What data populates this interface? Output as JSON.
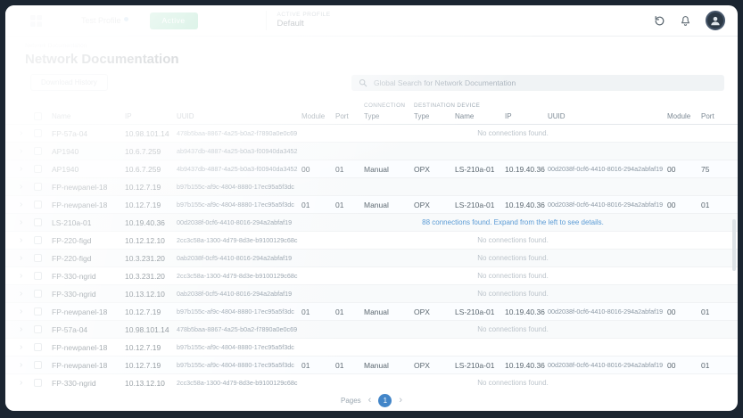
{
  "header": {
    "profile_name": "Test Profile",
    "active_button_label": "Active",
    "active_profile_label": "ACTIVE PROFILE",
    "active_profile_value": "Default"
  },
  "page": {
    "breadcrumb": "Network Documentation",
    "title": "Network Documentation",
    "history_button_label": "Download History",
    "search_placeholder": "Global Search for Network Documentation"
  },
  "icons": {
    "expand_chevron": "›"
  },
  "colors": {
    "accent_blue": "#4285c8",
    "active_green": "#2bb673",
    "info_blue": "#5b9bd5"
  },
  "table": {
    "groups": {
      "connection": "CONNECTION",
      "destination": "DESTINATION DEVICE"
    },
    "columns": {
      "name": "Name",
      "ip": "IP",
      "uuid": "UUID",
      "module": "Module",
      "port": "Port",
      "conn_type": "Type",
      "dest_type": "Type",
      "dest_name": "Name",
      "dest_ip": "IP",
      "dest_uuid": "UUID",
      "dest_module": "Module",
      "dest_port": "Port"
    },
    "rows": [
      {
        "name": "FP-57a-04",
        "ip": "10.98.101.14",
        "uuid": "478b5baa-8867-4a25-b0a2-f7890a0e0c69",
        "message": "No connections found."
      },
      {
        "name": "AP1940",
        "ip": "10.6.7.259",
        "uuid": "ab9437db-4887-4a25-b0a3-f00940da3452",
        "message": ""
      },
      {
        "name": "AP1940",
        "ip": "10.6.7.259",
        "uuid": "4b9437db-4887-4a25-b0a3-f00940da3452",
        "module": "00",
        "port": "01",
        "conn_type": "Manual",
        "dest_type": "OPX",
        "dest_name": "LS-210a-01",
        "dest_ip": "10.19.40.36",
        "dest_uuid": "00d2038f-0cf6-4410-8016-294a2abfaf19",
        "dest_module": "00",
        "dest_port": "75",
        "highlighted": true
      },
      {
        "name": "FP-newpanel-18",
        "ip": "10.12.7.19",
        "uuid": "b97b155c-af9c-4804-8880-17ec95a5f3dc",
        "message": ""
      },
      {
        "name": "FP-newpanel-18",
        "ip": "10.12.7.19",
        "uuid": "b97b155c-af9c-4804-8880-17ec95a5f3dc",
        "module": "01",
        "port": "01",
        "conn_type": "Manual",
        "dest_type": "OPX",
        "dest_name": "LS-210a-01",
        "dest_ip": "10.19.40.36",
        "dest_uuid": "00d2038f-0cf6-4410-8016-294a2abfaf19",
        "dest_module": "00",
        "dest_port": "01",
        "highlighted": true
      },
      {
        "name": "LS-210a-01",
        "ip": "10.19.40.36",
        "uuid": "00d2038f-0cf6-4410-8016-294a2abfaf19",
        "message": "88 connections found. Expand from the left to see details.",
        "info": true
      },
      {
        "name": "FP-220-figd",
        "ip": "10.12.12.10",
        "uuid": "2cc3c58a-1300-4d79-8d3e-b9100129c68c",
        "message": "No connections found."
      },
      {
        "name": "FP-220-figd",
        "ip": "10.3.231.20",
        "uuid": "0ab2038f-0cf5-4410-8016-294a2abfaf19",
        "message": "No connections found."
      },
      {
        "name": "FP-330-ngrid",
        "ip": "10.3.231.20",
        "uuid": "2cc3c58a-1300-4d79-8d3e-b9100129c68c",
        "message": "No connections found."
      },
      {
        "name": "FP-330-ngrid",
        "ip": "10.13.12.10",
        "uuid": "0ab2038f-0cf5-4410-8016-294a2abfaf19",
        "message": "No connections found."
      },
      {
        "name": "FP-newpanel-18",
        "ip": "10.12.7.19",
        "uuid": "b97b155c-af9c-4804-8880-17ec95a5f3dc",
        "module": "01",
        "port": "01",
        "conn_type": "Manual",
        "dest_type": "OPX",
        "dest_name": "LS-210a-01",
        "dest_ip": "10.19.40.36",
        "dest_uuid": "00d2038f-0cf6-4410-8016-294a2abfaf19",
        "dest_module": "00",
        "dest_port": "01",
        "highlighted": true
      },
      {
        "name": "FP-57a-04",
        "ip": "10.98.101.14",
        "uuid": "478b5baa-8867-4a25-b0a2-f7890a0e0c69",
        "message": "No connections found."
      },
      {
        "name": "FP-newpanel-18",
        "ip": "10.12.7.19",
        "uuid": "b97b155c-af9c-4804-8880-17ec95a5f3dc",
        "message": ""
      },
      {
        "name": "FP-newpanel-18",
        "ip": "10.12.7.19",
        "uuid": "b97b155c-af9c-4804-8880-17ec95a5f3dc",
        "module": "01",
        "port": "01",
        "conn_type": "Manual",
        "dest_type": "OPX",
        "dest_name": "LS-210a-01",
        "dest_ip": "10.19.40.36",
        "dest_uuid": "00d2038f-0cf6-4410-8016-294a2abfaf19",
        "dest_module": "00",
        "dest_port": "01",
        "highlighted": true
      },
      {
        "name": "FP-330-ngrid",
        "ip": "10.13.12.10",
        "uuid": "2cc3c58a-1300-4d79-8d3e-b9100129c68c",
        "message": "No connections found."
      }
    ]
  },
  "pagination": {
    "label": "Pages",
    "prev": "‹",
    "current": "1",
    "next": "›"
  }
}
